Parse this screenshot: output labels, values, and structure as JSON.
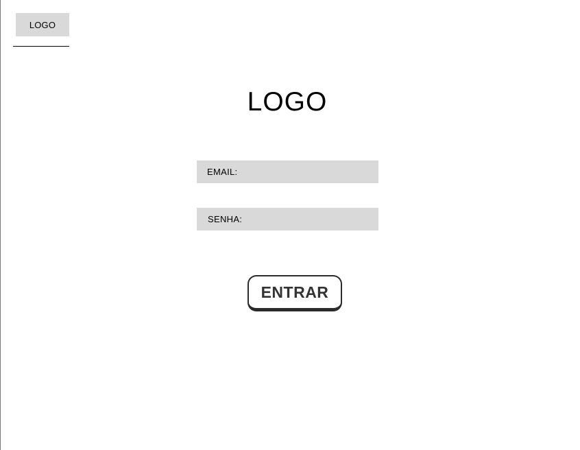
{
  "header": {
    "logo_text": "LOGO"
  },
  "login": {
    "logo_text": "LOGO",
    "email": {
      "label": "EMAIL:",
      "value": ""
    },
    "senha": {
      "label": "SENHA:",
      "value": ""
    },
    "submit_label": "ENTRAR"
  },
  "colors": {
    "field_background": "#d9d9d9",
    "button_border": "#2b2b2b",
    "text": "#000000"
  }
}
